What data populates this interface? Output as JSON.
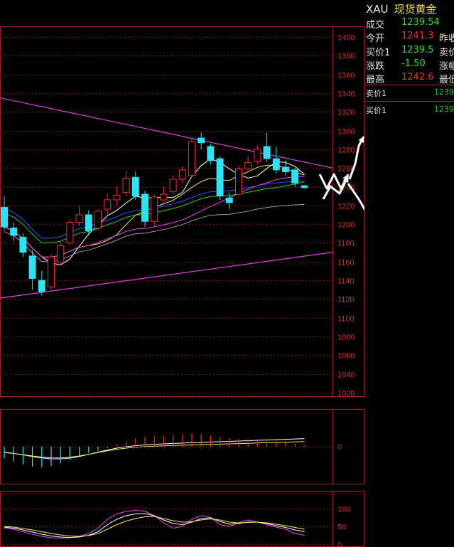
{
  "quote": {
    "code": "XAU",
    "name": "现货黄金",
    "rows": [
      {
        "label": "成交",
        "value": "1239.54",
        "label2": "",
        "value_color": "#33dd33"
      },
      {
        "label": "今开",
        "value": "1241.3",
        "label2": "昨收",
        "value_color": "#ee3333"
      },
      {
        "label": "买价1",
        "value": "1239.5",
        "label2": "卖价",
        "value_color": "#33dd33"
      },
      {
        "label": "涨跌",
        "value": "-1.50",
        "label2": "涨幅",
        "value_color": "#33dd33"
      },
      {
        "label": "最高",
        "value": "1242.6",
        "label2": "最低",
        "value_color": "#ee3333"
      }
    ],
    "orderbook": [
      {
        "label": "卖价1",
        "value": "1239"
      },
      {
        "label": "买价1",
        "value": "1239"
      }
    ]
  },
  "colors": {
    "up": "#ee3333",
    "down": "#33e0f0",
    "grid": "#7a1010",
    "ma5": "#ffffff",
    "ma10": "#eeee55",
    "ma20": "#ee44ee",
    "ma30": "#33cc33",
    "ma60": "#3355ff",
    "ma120": "#999999",
    "trendline": "#dd44dd",
    "annotation_arrow": "#ffffff"
  },
  "chart_data": [
    {
      "type": "candlestick",
      "panel": "price",
      "ylim": [
        1020,
        1400
      ],
      "y_ticks": [
        1400,
        1380,
        1360,
        1340,
        1320,
        1300,
        1280,
        1260,
        1240,
        1220,
        1200,
        1180,
        1160,
        1140,
        1120,
        1100,
        1080,
        1060,
        1040,
        1020
      ],
      "candles": [
        {
          "o": 1218,
          "h": 1230,
          "c": 1197,
          "l": 1193
        },
        {
          "o": 1196,
          "h": 1202,
          "c": 1188,
          "l": 1182
        },
        {
          "o": 1186,
          "h": 1190,
          "c": 1170,
          "l": 1165
        },
        {
          "o": 1166,
          "h": 1172,
          "c": 1142,
          "l": 1130
        },
        {
          "o": 1140,
          "h": 1150,
          "c": 1128,
          "l": 1124
        },
        {
          "o": 1133,
          "h": 1168,
          "c": 1165,
          "l": 1130
        },
        {
          "o": 1159,
          "h": 1182,
          "c": 1177,
          "l": 1156
        },
        {
          "o": 1180,
          "h": 1204,
          "c": 1202,
          "l": 1178
        },
        {
          "o": 1202,
          "h": 1220,
          "c": 1210,
          "l": 1198
        },
        {
          "o": 1210,
          "h": 1215,
          "c": 1193,
          "l": 1188
        },
        {
          "o": 1196,
          "h": 1216,
          "c": 1214,
          "l": 1194
        },
        {
          "o": 1216,
          "h": 1233,
          "c": 1226,
          "l": 1210
        },
        {
          "o": 1226,
          "h": 1240,
          "c": 1231,
          "l": 1220
        },
        {
          "o": 1234,
          "h": 1256,
          "c": 1249,
          "l": 1230
        },
        {
          "o": 1250,
          "h": 1256,
          "c": 1230,
          "l": 1226
        },
        {
          "o": 1232,
          "h": 1236,
          "c": 1203,
          "l": 1197
        },
        {
          "o": 1203,
          "h": 1232,
          "c": 1229,
          "l": 1197
        },
        {
          "o": 1226,
          "h": 1240,
          "c": 1232,
          "l": 1222
        },
        {
          "o": 1235,
          "h": 1252,
          "c": 1248,
          "l": 1232
        },
        {
          "o": 1248,
          "h": 1262,
          "c": 1258,
          "l": 1244
        },
        {
          "o": 1252,
          "h": 1292,
          "c": 1288,
          "l": 1250
        },
        {
          "o": 1292,
          "h": 1298,
          "c": 1287,
          "l": 1280
        },
        {
          "o": 1283,
          "h": 1286,
          "c": 1268,
          "l": 1264
        },
        {
          "o": 1270,
          "h": 1273,
          "c": 1230,
          "l": 1226
        },
        {
          "o": 1228,
          "h": 1234,
          "c": 1223,
          "l": 1216
        },
        {
          "o": 1232,
          "h": 1262,
          "c": 1259,
          "l": 1230
        },
        {
          "o": 1259,
          "h": 1272,
          "c": 1266,
          "l": 1255
        },
        {
          "o": 1267,
          "h": 1284,
          "c": 1280,
          "l": 1264
        },
        {
          "o": 1283,
          "h": 1298,
          "c": 1270,
          "l": 1266
        },
        {
          "o": 1270,
          "h": 1283,
          "c": 1258,
          "l": 1254
        },
        {
          "o": 1261,
          "h": 1268,
          "c": 1256,
          "l": 1252
        },
        {
          "o": 1258,
          "h": 1260,
          "c": 1244,
          "l": 1240
        },
        {
          "o": 1241,
          "h": 1242,
          "c": 1239,
          "l": 1238
        }
      ],
      "annotations": [
        "trend lines",
        "forecast arrows"
      ]
    },
    {
      "type": "bar",
      "panel": "macd",
      "y_ticks": [
        0
      ],
      "ylim": [
        -1,
        1
      ],
      "values": [
        -0.4,
        -0.52,
        -0.62,
        -0.7,
        -0.72,
        -0.68,
        -0.58,
        -0.46,
        -0.32,
        -0.22,
        -0.14,
        -0.04,
        0.08,
        0.18,
        0.28,
        0.34,
        0.36,
        0.38,
        0.42,
        0.44,
        0.46,
        0.44,
        0.4,
        0.34,
        0.3,
        0.26,
        0.24,
        0.22,
        0.2,
        0.18,
        0.14,
        0.1,
        0.06
      ]
    },
    {
      "type": "line",
      "panel": "kdj",
      "y_ticks": [
        100,
        50,
        0
      ],
      "ylim": [
        0,
        130
      ],
      "series": [
        {
          "color": "#ee44ee",
          "values": [
            45,
            42,
            35,
            28,
            22,
            18,
            17,
            18,
            22,
            30,
            45,
            70,
            85,
            92,
            95,
            93,
            80,
            60,
            45,
            50,
            70,
            80,
            75,
            55,
            50,
            60,
            68,
            62,
            55,
            48,
            42,
            30,
            25
          ]
        },
        {
          "color": "#ffffff",
          "values": [
            48,
            45,
            40,
            34,
            28,
            23,
            20,
            19,
            20,
            25,
            35,
            55,
            70,
            80,
            85,
            86,
            80,
            68,
            58,
            55,
            62,
            72,
            74,
            64,
            56,
            58,
            62,
            62,
            58,
            52,
            47,
            40,
            35
          ]
        },
        {
          "color": "#eeee55",
          "values": [
            50,
            48,
            44,
            40,
            35,
            30,
            26,
            23,
            22,
            24,
            30,
            42,
            55,
            65,
            72,
            77,
            78,
            72,
            66,
            62,
            63,
            68,
            71,
            68,
            62,
            60,
            61,
            62,
            60,
            56,
            52,
            47,
            42
          ]
        }
      ]
    }
  ]
}
